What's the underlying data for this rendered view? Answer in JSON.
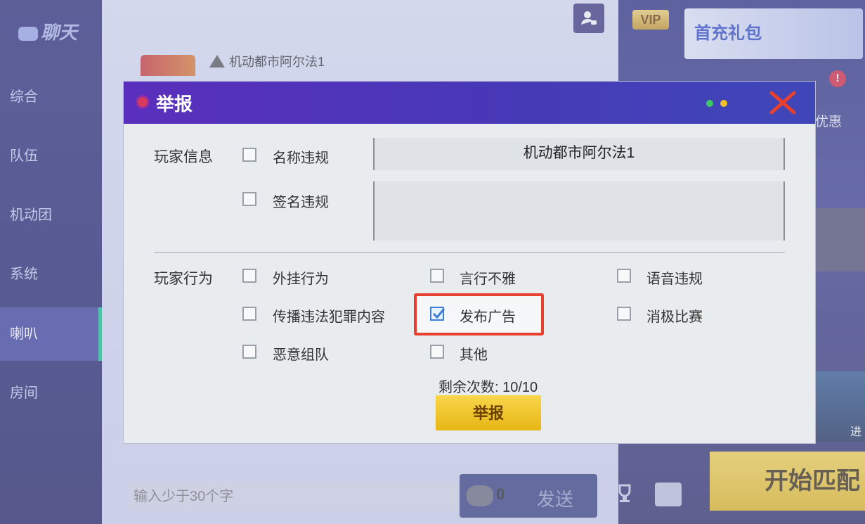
{
  "nav": {
    "title": "聊天",
    "items": [
      {
        "label": "综合",
        "active": false
      },
      {
        "label": "队伍",
        "active": false
      },
      {
        "label": "机动团",
        "active": false
      },
      {
        "label": "系统",
        "active": false
      },
      {
        "label": "喇叭",
        "active": true
      },
      {
        "label": "房间",
        "active": false
      }
    ]
  },
  "chat": {
    "player_name": "机动都市阿尔法1",
    "input_placeholder": "输入少于30个字",
    "coin_count": "0",
    "send_label": "发送"
  },
  "right": {
    "vip_label": "VIP",
    "gift_label": "首充礼包",
    "promo_label": "优惠",
    "thumb_label": "进",
    "start_match_label": "开始匹配"
  },
  "modal": {
    "title": "举报",
    "player_info_label": "玩家信息",
    "player_behavior_label": "玩家行为",
    "name_violation": {
      "label": "名称违规",
      "checked": false
    },
    "signature_violation": {
      "label": "签名违规",
      "checked": false
    },
    "name_value": "机动都市阿尔法1",
    "signature_value": "",
    "behaviors": [
      {
        "label": "外挂行为",
        "checked": false
      },
      {
        "label": "言行不雅",
        "checked": false
      },
      {
        "label": "语音违规",
        "checked": false
      },
      {
        "label": "传播违法犯罪内容",
        "checked": false
      },
      {
        "label": "发布广告",
        "checked": true
      },
      {
        "label": "消极比赛",
        "checked": false
      },
      {
        "label": "恶意组队",
        "checked": false
      },
      {
        "label": "其他",
        "checked": false
      }
    ],
    "remaining_text": "剩余次数: 10/10",
    "submit_label": "举报"
  },
  "colors": {
    "header_start": "#5a2fbd",
    "header_end": "#3f47b8",
    "submit": "#f2c52e",
    "highlight": "#e7402f",
    "check": "#3d7fd4"
  }
}
